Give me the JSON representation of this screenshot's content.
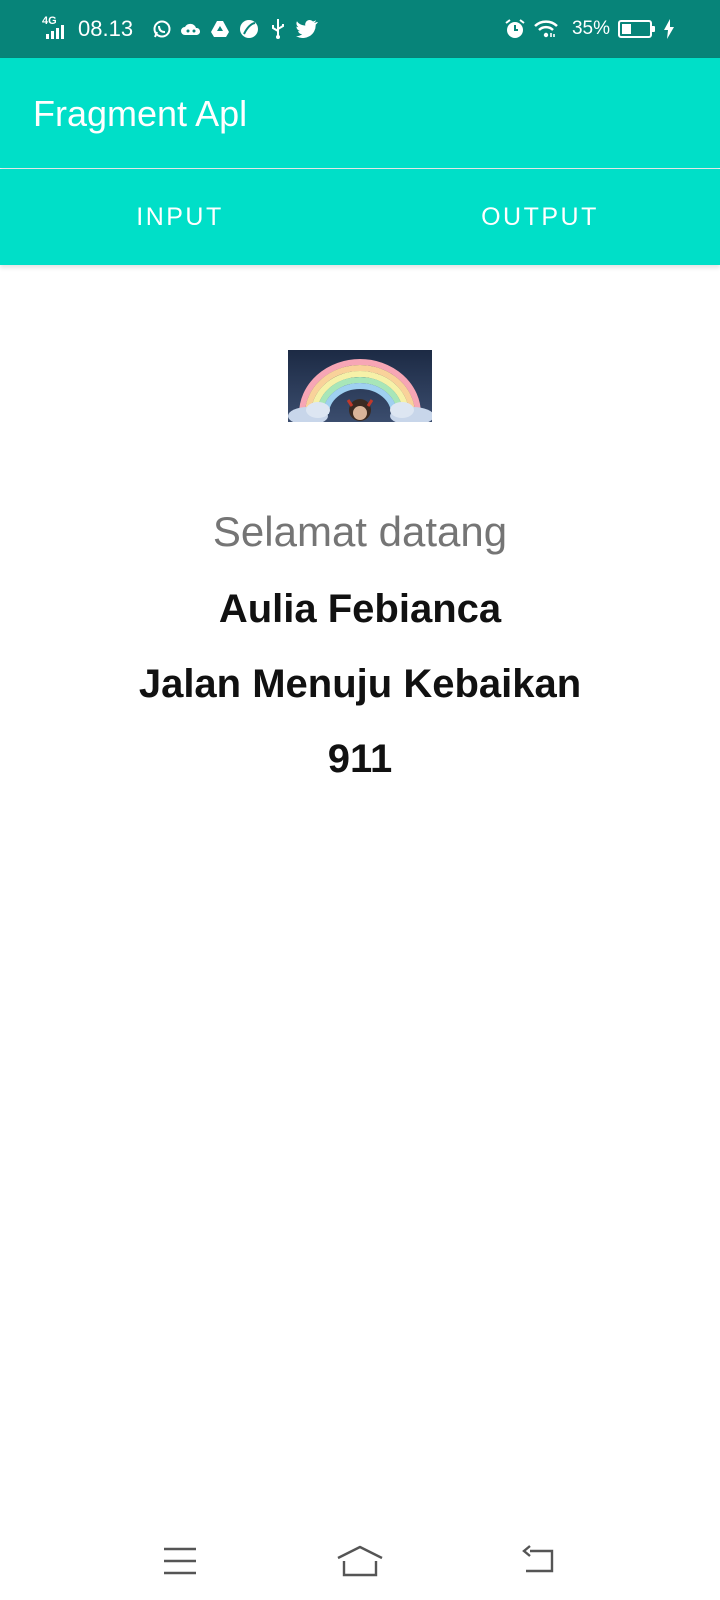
{
  "status_bar": {
    "network": "4G",
    "time": "08.13",
    "notification_icons": [
      "whatsapp-icon",
      "cloud-game-icon",
      "drive-icon",
      "leaf-app-icon",
      "usb-icon",
      "twitter-icon"
    ],
    "right_icons": [
      "alarm-icon",
      "wifi-icon"
    ],
    "battery_percent": "35%",
    "battery_level": 0.35,
    "charging": true
  },
  "app_bar": {
    "title": "Fragment Apl"
  },
  "tabs": [
    {
      "label": "INPUT"
    },
    {
      "label": "OUTPUT"
    }
  ],
  "output": {
    "image": "rainbow-profile-image",
    "greeting": "Selamat datang",
    "name": "Aulia Febianca",
    "address": "Jalan Menuju Kebaikan",
    "number": "911"
  },
  "nav_bar": {
    "buttons": [
      "menu-icon",
      "home-icon",
      "back-icon"
    ]
  },
  "colors": {
    "status_bar": "#078479",
    "accent": "#00DFC8",
    "greeting_text": "#757575",
    "body_text": "#111111"
  }
}
